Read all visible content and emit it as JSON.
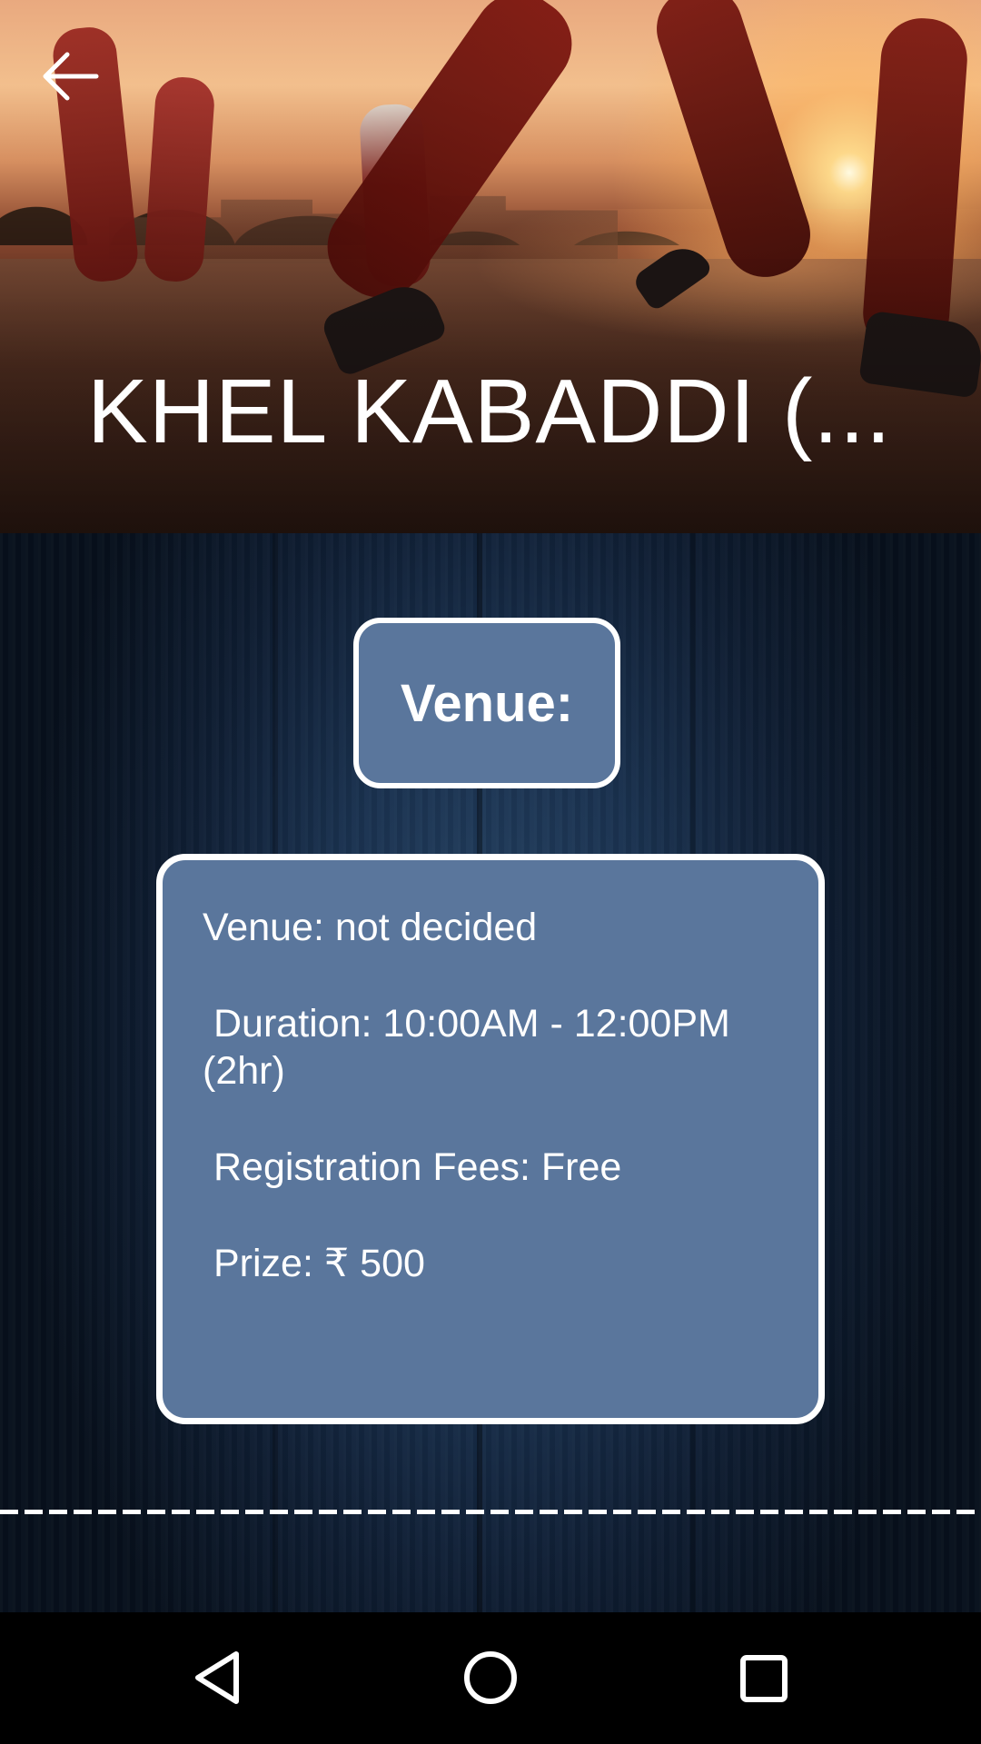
{
  "header": {
    "title": "KHEL KABADDI (..."
  },
  "venue_section": {
    "heading": "Venue:",
    "details": {
      "venue": "Venue: not decided",
      "duration": "Duration: 10:00AM - 12:00PM (2hr)",
      "registration_fees": "Registration Fees: Free",
      "prize": "Prize: ₹ 500"
    }
  },
  "icons": {
    "back": "arrow-left-icon",
    "nav_back": "triangle-back-icon",
    "nav_home": "circle-home-icon",
    "nav_recent": "square-recents-icon"
  },
  "colors": {
    "panel_fill": "#5a769c",
    "panel_border": "#ffffff",
    "background_dark": "#0e1c30",
    "navbar": "#000000"
  }
}
